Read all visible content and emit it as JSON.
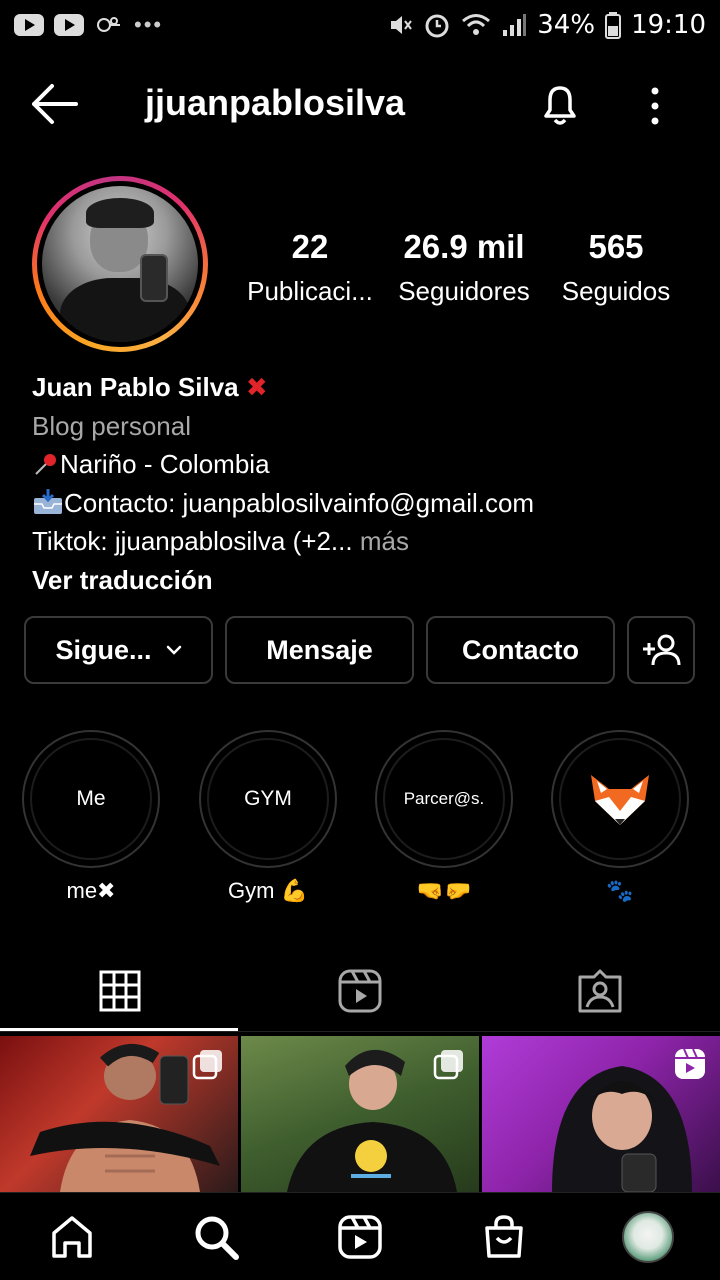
{
  "status_bar": {
    "battery": "34%",
    "time": "19:10"
  },
  "header": {
    "username": "jjuanpablosilva"
  },
  "profile": {
    "stats": [
      {
        "value": "22",
        "label": "Publicaci..."
      },
      {
        "value": "26.9 mil",
        "label": "Seguidores"
      },
      {
        "value": "565",
        "label": "Seguidos"
      }
    ],
    "name": "Juan Pablo Silva",
    "name_emoji": "✖",
    "category": "Blog personal",
    "location": "Nariño - Colombia",
    "contact_line": "Contacto: juanpablosilvainfo@gmail.com",
    "tiktok_line": "Tiktok: jjuanpablosilva (+2...",
    "more": "más",
    "translate": "Ver traducción"
  },
  "buttons": {
    "following": "Sigue...",
    "message": "Mensaje",
    "contact": "Contacto"
  },
  "highlights": [
    {
      "cover_text": "Me",
      "label": "me✖"
    },
    {
      "cover_text": "GYM",
      "label": "Gym 💪"
    },
    {
      "cover_text": "Parcer@s.",
      "label": "🤜🤛"
    },
    {
      "cover_text": "",
      "label": "🐾"
    }
  ],
  "colors": {
    "accent_red": "#e0242a",
    "muted": "#a8a8a8"
  },
  "icons": [
    "back-arrow-icon",
    "bell-icon",
    "kebab-icon",
    "grid-icon",
    "reels-icon",
    "tagged-icon",
    "home-icon",
    "search-icon",
    "shop-icon",
    "add-user-icon"
  ]
}
